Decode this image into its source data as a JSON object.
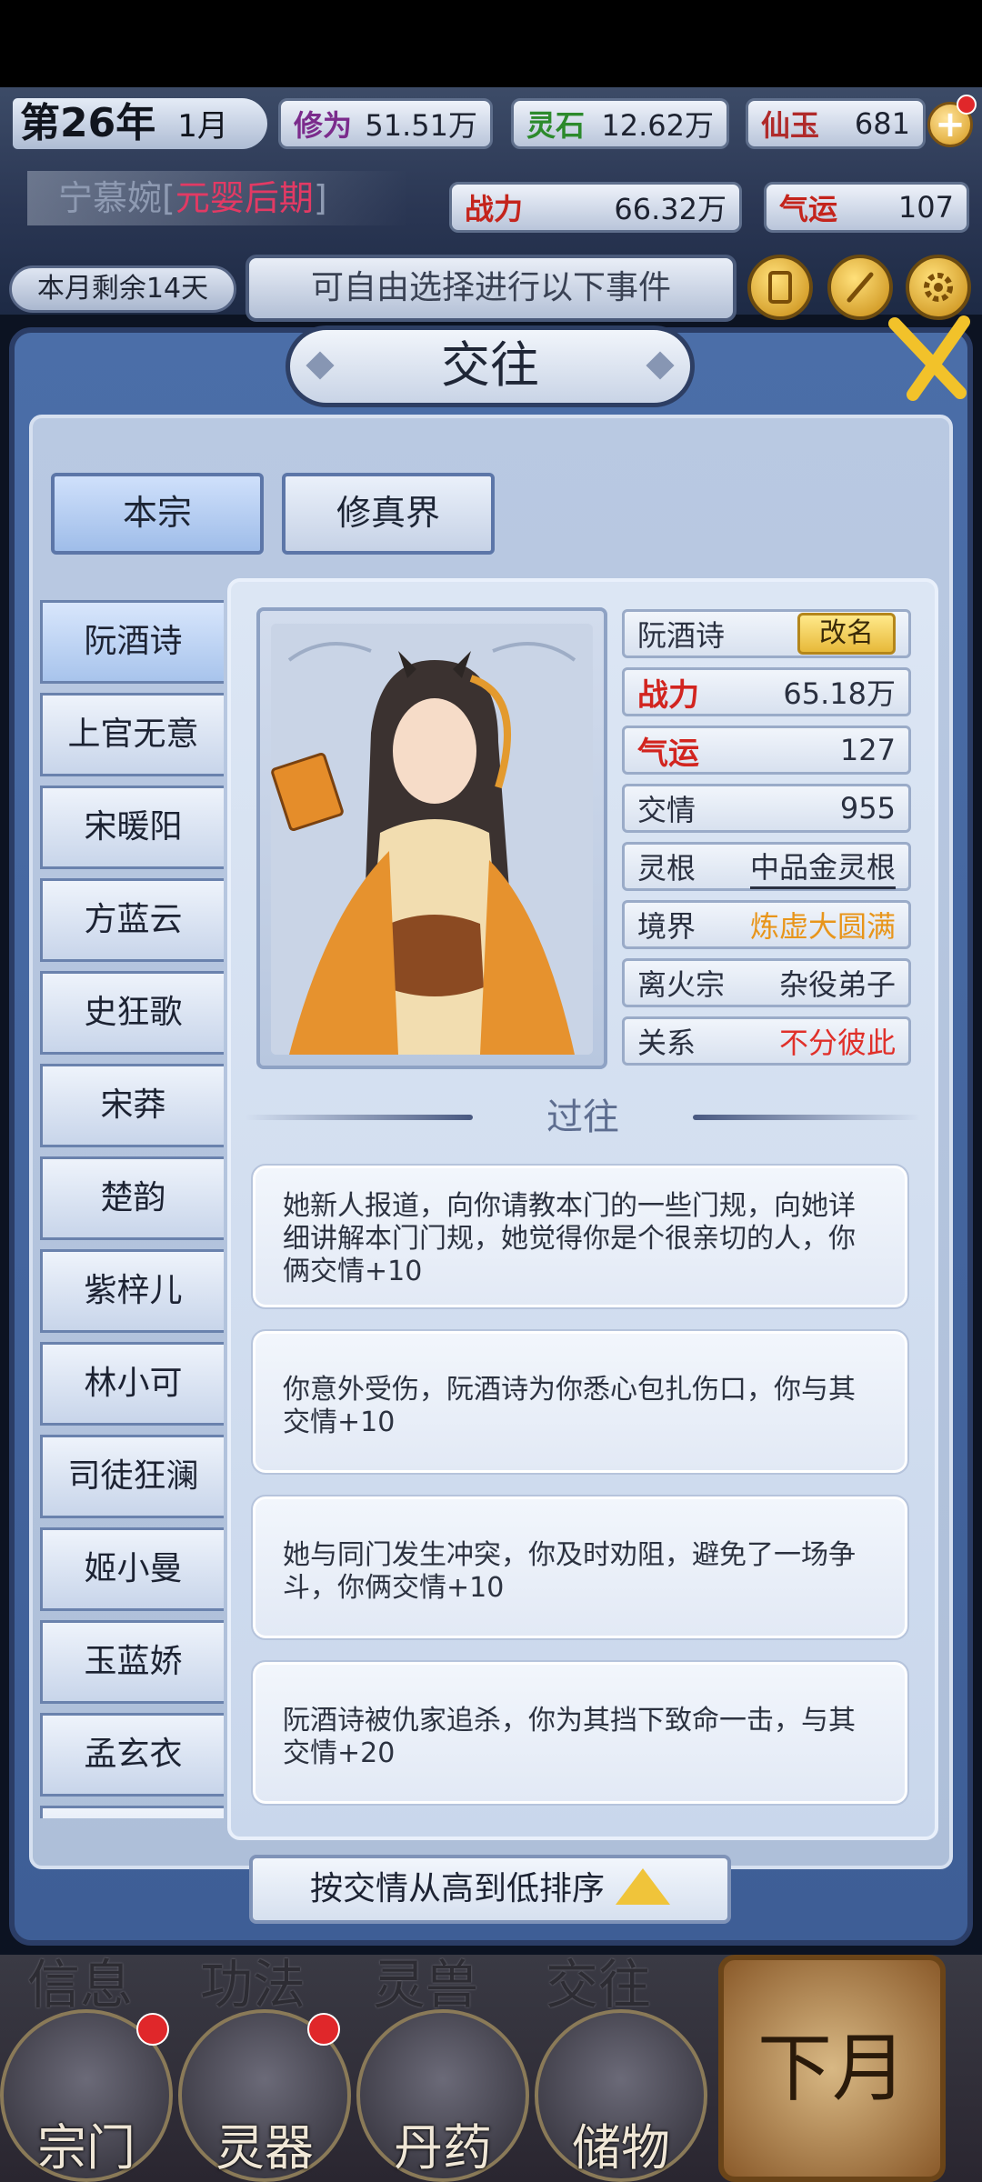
{
  "hud": {
    "year": "第26年",
    "month": "1月",
    "xiuwei_label": "修为",
    "xiuwei_value": "51.51万",
    "lingshi_label": "灵石",
    "lingshi_value": "12.62万",
    "xianyu_label": "仙玉",
    "xianyu_value": "681",
    "plus": "+",
    "player_name": "宁慕婉",
    "player_realm": "元婴后期",
    "bracket_open": "[",
    "bracket_close": "]",
    "zhanli_label": "战力",
    "zhanli_value": "66.32万",
    "qiyun_label": "气运",
    "qiyun_value": "107",
    "remaining_days": "本月剩余14天",
    "event_hint": "可自由选择进行以下事件",
    "icons": [
      "scroll-icon",
      "brush-icon",
      "gear-icon"
    ]
  },
  "panel": {
    "title": "交往",
    "tabs": [
      {
        "label": "本宗",
        "active": true
      },
      {
        "label": "修真界",
        "active": false
      }
    ],
    "contacts": [
      "阮酒诗",
      "上官无意",
      "宋暖阳",
      "方蓝云",
      "史狂歌",
      "宋莽",
      "楚韵",
      "紫梓儿",
      "林小可",
      "司徒狂澜",
      "姬小曼",
      "玉蓝娇",
      "孟玄衣"
    ],
    "selected_contact": 0
  },
  "detail": {
    "name": "阮酒诗",
    "rename_label": "改名",
    "stats": [
      {
        "label": "战力",
        "value": "65.18万",
        "style": "red-label"
      },
      {
        "label": "气运",
        "value": "127",
        "style": "red-label"
      },
      {
        "label": "交情",
        "value": "955",
        "style": "plain"
      },
      {
        "label": "灵根",
        "value": "中品金灵根",
        "style": "underline"
      },
      {
        "label": "境界",
        "value": "炼虚大圆满",
        "style": "orange"
      },
      {
        "label": "离火宗",
        "value": "杂役弟子",
        "style": "plain"
      },
      {
        "label": "关系",
        "value": "不分彼此",
        "style": "red"
      }
    ],
    "past_title": "过往",
    "events": [
      "她新人报道，向你请教本门的一些门规，向她详细讲解本门门规，她觉得你是个很亲切的人，你俩交情+10",
      "你意外受伤，阮酒诗为你悉心包扎伤口，你与其交情+10",
      "她与同门发生冲突，你及时劝阻，避免了一场争斗，你俩交情+10",
      "阮酒诗被仇家追杀，你为其挡下致命一击，与其交情+20"
    ]
  },
  "sort_label": "按交情从高到低排序",
  "bottom_nav": {
    "top_row": [
      "信息",
      "功法",
      "灵兽",
      "交往"
    ],
    "buttons": [
      "宗门",
      "灵器",
      "丹药",
      "储物"
    ],
    "next_month": "下月"
  },
  "colors": {
    "panel_blue": "#4b6ea8",
    "accent_gold": "#f2c22a",
    "realm_pink": "#e23a64",
    "stat_red": "#d2241f",
    "orange": "#e8951a"
  }
}
